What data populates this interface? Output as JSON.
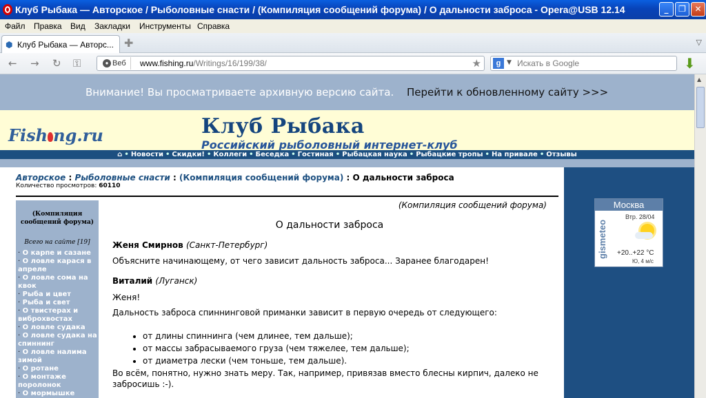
{
  "window": {
    "title": "Клуб Рыбака — Авторское / Рыболовные снасти / (Компиляция сообщений форума) / О дальности заброса - Opera@USB 12.14",
    "controls": [
      "_",
      "❐",
      "✕"
    ]
  },
  "menu": [
    "Файл",
    "Правка",
    "Вид",
    "Закладки",
    "Инструменты",
    "Справка"
  ],
  "tab": {
    "title": "Клуб Рыбака — Авторс..."
  },
  "address": {
    "mode_label": "Веб",
    "domain": "www.fishing.ru",
    "path": "/Writings/16/199/38/"
  },
  "search": {
    "placeholder": "Искать в Google"
  },
  "banner": {
    "message": "Внимание! Вы просматриваете архивную версию сайта.",
    "link": "Перейти к обновленному сайту >>>"
  },
  "site": {
    "logo_pre": "Fish",
    "logo_post": "ng.ru",
    "name": "Клуб Рыбака",
    "subtitle": "Российский рыболовный интернет-клуб"
  },
  "topnav": [
    "Новости",
    "Скидки!",
    "Коллеги",
    "Беседка",
    "Гостиная",
    "Рыбацкая наука",
    "Рыбацкие тропы",
    "На привале",
    "Отзывы"
  ],
  "breadcrumb": {
    "c1": "Авторское",
    "c2": "Рыболовные снасти",
    "c3": "(Компиляция сообщений форума)",
    "current": "О дальности заброса",
    "sep": " : "
  },
  "views": {
    "label": "Количество просмотров:",
    "value": "60110"
  },
  "sidebar": {
    "section": "(Компиляция сообщений форума)",
    "total": "Всего на сайте [19]",
    "items": [
      "О карпе и сазане",
      "О ловле карася в апреле",
      "О ловле сома на квок",
      "Рыба и цвет",
      "Рыба и свет",
      "О твистерах и виброхвостах",
      "О ловле судака",
      "О ловле судака на спиннинг",
      "О ловле налима зимой",
      "О ротане",
      "О монтаже поролонок",
      "О мормышке"
    ]
  },
  "article": {
    "source": "(Компиляция сообщений форума)",
    "title": "О дальности заброса",
    "author1": {
      "name": "Женя Смирнов",
      "city": "(Санкт-Петербург)"
    },
    "question": "Объясните начинающему, от чего зависит дальность заброса... Заранее благодарен!",
    "author2": {
      "name": "Виталий",
      "city": "(Луганск)"
    },
    "greeting": "Женя!",
    "intro": "Дальность заброса спиннинговой приманки зависит в первую очередь от следующего:",
    "reasons": [
      "от длины спиннинга (чем длинее, тем дальше);",
      "от массы забрасываемого груза (чем тяжелее, тем дальше);",
      "от диаметра лески (чем тоньше, тем дальше)."
    ],
    "outro1": "Во всём, понятно, нужно знать меру. Так, например, привязав вместо блесны кирпич, далеко не",
    "outro2": "забросишь :-)."
  },
  "weather": {
    "city": "Москва",
    "brand": "gismeteo",
    "date": "Втр. 28/04",
    "temp": "+20..+22 °C",
    "wind": "Ю, 4 м/с"
  }
}
